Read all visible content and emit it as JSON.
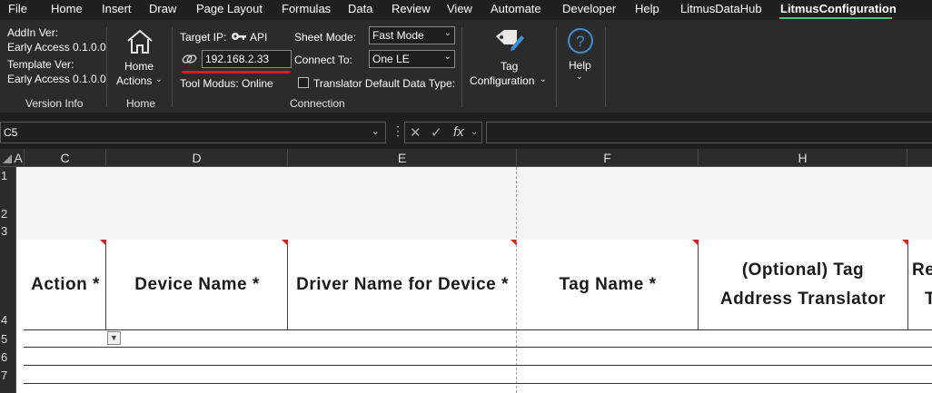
{
  "menu": {
    "tabs": [
      "File",
      "Home",
      "Insert",
      "Draw",
      "Page Layout",
      "Formulas",
      "Data",
      "Review",
      "View",
      "Automate",
      "Developer",
      "Help",
      "LitmusDataHub",
      "LitmusConfiguration"
    ],
    "active": "LitmusConfiguration"
  },
  "ribbon": {
    "version_info": {
      "addin_label": "AddIn Ver:",
      "addin_value": "Early Access 0.1.0.0",
      "template_label": "Template Ver:",
      "template_value": "Early Access 0.1.0.0",
      "group_label": "Version Info"
    },
    "home": {
      "button_line1": "Home",
      "button_line2": "Actions",
      "group_label": "Home"
    },
    "connection": {
      "target_ip_label": "Target IP:",
      "api_label": "API",
      "ip_value": "192.168.2.33",
      "tool_modus": "Tool Modus: Online",
      "sheet_mode_label": "Sheet Mode:",
      "sheet_mode_value": "Fast Mode",
      "connect_to_label": "Connect To:",
      "connect_to_value": "One LE",
      "translator_label": "Translator Default Data Type:",
      "group_label": "Connection"
    },
    "tag_config": {
      "line1": "Tag",
      "line2": "Configuration"
    },
    "help": {
      "label": "Help"
    }
  },
  "formula_bar": {
    "name_box": "C5",
    "fx": "fx",
    "formula": ""
  },
  "columns": [
    "A",
    "C",
    "D",
    "E",
    "F",
    "H"
  ],
  "rows": [
    "1",
    "2",
    "3",
    "4",
    "5",
    "6",
    "7"
  ],
  "headers": {
    "action": "Action *",
    "device_name": "Device Name *",
    "driver_name": "Driver Name for Device *",
    "tag_name": "Tag Name *",
    "address_translator_l1": "(Optional) Tag",
    "address_translator_l2": "Address Translator",
    "partial_l1": "Re",
    "partial_l2": "T"
  },
  "colors": {
    "accent_tab_underline": "#4ec27a",
    "ip_highlight": "#e01818",
    "comment_indicator": "#d82020"
  }
}
